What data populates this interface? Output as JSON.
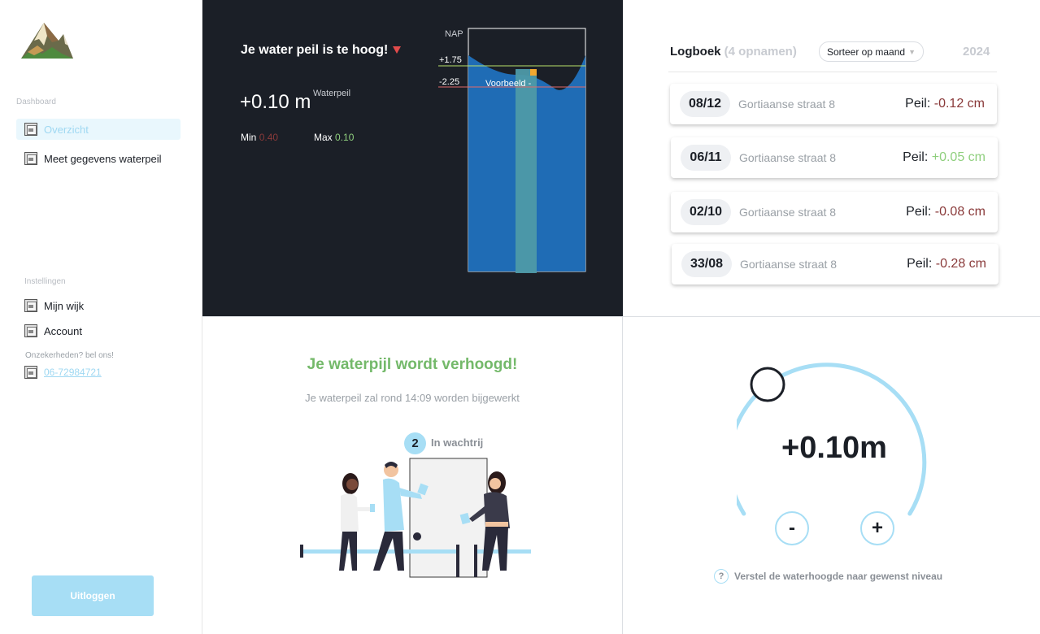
{
  "sidebar": {
    "dashboard_label": "Dashboard",
    "items": [
      {
        "label": "Overzicht"
      },
      {
        "label": "Meet gegevens waterpeil"
      }
    ],
    "settings_label": "Instellingen",
    "settings_items": [
      {
        "label": "Mijn wijk"
      },
      {
        "label": "Account"
      }
    ],
    "help_text": "Onzekerheden? bel ons!",
    "phone": "06-72984721",
    "logout_label": "Uitloggen"
  },
  "status": {
    "title": "Je water peil is te hoog!",
    "value": "+0.10 m",
    "value_label": "Waterpeil",
    "min_label": "Min",
    "min_value": "0.40",
    "max_label": "Max",
    "max_value": "0.10",
    "chart": {
      "axis_label": "NAP",
      "upper_tick": "+1.75",
      "lower_tick": "-2.25",
      "example_label": "Voorbeeld -"
    }
  },
  "logbook": {
    "title": "Logboek",
    "count": "(4 opnamen)",
    "sort_label": "Sorteer op maand",
    "year": "2024",
    "entries": [
      {
        "date": "08/12",
        "address": "Gortiaanse straat 8",
        "peil_label": "Peil:",
        "peil_value": "-0.12 cm"
      },
      {
        "date": "06/11",
        "address": "Gortiaanse straat 8",
        "peil_label": "Peil:",
        "peil_value": "+0.05 cm"
      },
      {
        "date": "02/10",
        "address": "Gortiaanse straat 8",
        "peil_label": "Peil:",
        "peil_value": "-0.08 cm"
      },
      {
        "date": "33/08",
        "address": "Gortiaanse straat 8",
        "peil_label": "Peil:",
        "peil_value": "-0.28 cm"
      }
    ]
  },
  "queue": {
    "title": "Je waterpijl wordt verhoogd!",
    "subtitle": "Je waterpeil zal rond 14:09 worden bijgewerkt",
    "position": "2",
    "status": "In wachtrij"
  },
  "adjust": {
    "value": "+0.10m",
    "minus_label": "-",
    "plus_label": "+",
    "hint_icon": "?",
    "hint": "Verstel de waterhoogde naar gewenst niveau"
  },
  "colors": {
    "accent": "#a7def5",
    "dark": "#1b1f27",
    "negative": "#8a3a3a",
    "positive": "#8fcf7e",
    "green_title": "#74b96a",
    "water": "#1f6cb5"
  }
}
